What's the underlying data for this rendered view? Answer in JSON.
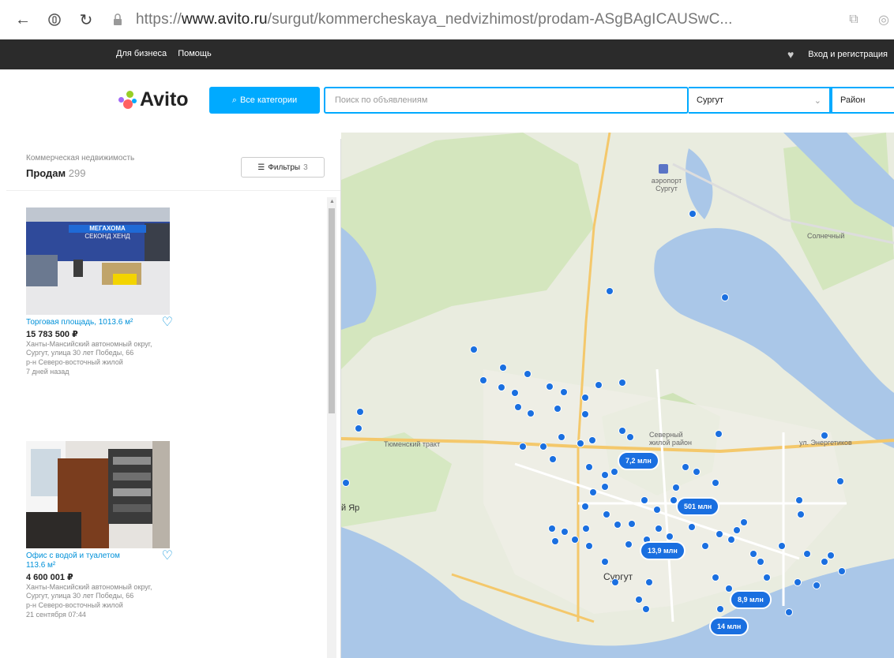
{
  "browser": {
    "url_prefix": "https://",
    "url_domain": "www.avito.ru",
    "url_path": "/surgut/kommercheskaya_nedvizhimost/prodam-ASgBAgICAUSwC..."
  },
  "topbar": {
    "links": [
      "Для бизнеса",
      "Помощь"
    ],
    "login": "Вход и регистрация"
  },
  "header": {
    "logo": "Avito",
    "categories_button": "Все категории",
    "search_placeholder": "Поиск по объявлениям",
    "city": "Сургут",
    "district": "Район"
  },
  "panel": {
    "breadcrumb": "Коммерческая недвижимость",
    "title": "Продам",
    "count": "299",
    "filters_label": "Фильтры",
    "filters_count": "3"
  },
  "listings": [
    {
      "sign_text_1": "МЕГАХОМА",
      "sign_text_2": "СЕКОНД ХЕНД",
      "title": "Торговая площадь, 1013.6 м²",
      "price": "15 783 500 ₽",
      "address": "Ханты-Мансийский автономный округ, Сургут, улица 30 лет Победы, 66",
      "district": "р-н Северо-восточный жилой",
      "date": "7 дней назад"
    },
    {
      "title": "Офис с водой и туалетом 113.6 м²",
      "price": "4 600 001 ₽",
      "address": "Ханты-Мансийский автономный округ, Сургут, улица 30 лет Победы, 66",
      "district": "р-н Северо-восточный жилой",
      "date": "21 сентября 07:44"
    }
  ],
  "map": {
    "labels": {
      "airport": "аэропорт Сургут",
      "tyumen_road": "Тюменский тракт",
      "city": "Сургут",
      "yar": "й Яр",
      "district_label": "Северный жилой район",
      "village": "Солнечный",
      "street_right": "ул. Энергетиков"
    },
    "clusters": [
      "7,2 млн",
      "501 млн",
      "13,9 млн",
      "8,9 млн",
      "14 млн"
    ],
    "colors": {
      "pin": "#1a6fe0",
      "water": "#aac7e8",
      "land": "#e9ecdf",
      "forest": "#cfe3b8",
      "road": "#f4c86b"
    }
  }
}
